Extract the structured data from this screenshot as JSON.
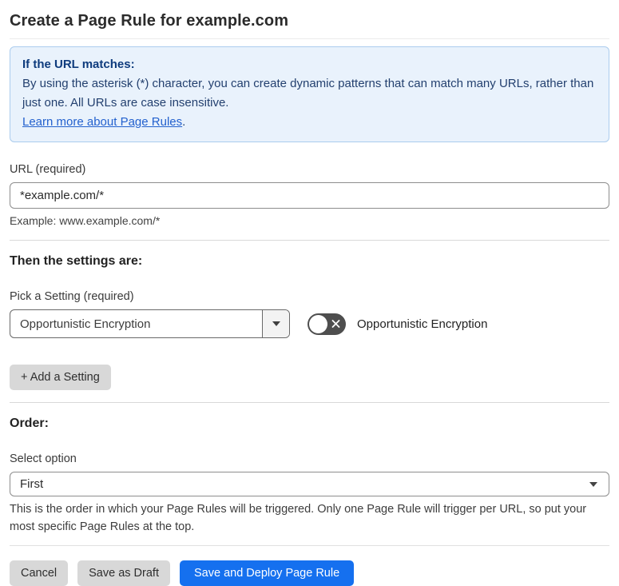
{
  "page": {
    "title": "Create a Page Rule for example.com"
  },
  "info_box": {
    "heading": "If the URL matches:",
    "body": "By using the asterisk (*) character, you can create dynamic patterns that can match many URLs, rather than just one. All URLs are case insensitive.",
    "link_label": "Learn more about Page Rules",
    "link_suffix": "."
  },
  "url_field": {
    "label": "URL (required)",
    "value": "*example.com/*",
    "helper": "Example: www.example.com/*"
  },
  "settings_section": {
    "heading": "Then the settings are:",
    "picker_label": "Pick a Setting (required)",
    "picker_value": "Opportunistic Encryption",
    "toggle_state": "off",
    "toggle_label": "Opportunistic Encryption",
    "add_setting_label": "+ Add a Setting"
  },
  "order_section": {
    "heading": "Order:",
    "select_label": "Select option",
    "select_value": "First",
    "helper": "This is the order in which your Page Rules will be triggered. Only one Page Rule will trigger per URL, so put your most specific Page Rules at the top."
  },
  "actions": {
    "cancel_label": "Cancel",
    "save_draft_label": "Save as Draft",
    "save_deploy_label": "Save and Deploy Page Rule"
  },
  "colors": {
    "accent_blue": "#1570ef",
    "info_background": "#e9f2fc",
    "info_border": "#abccee",
    "info_text": "#23406f",
    "link_blue": "#2361ce",
    "toggle_off_background": "#4e4e4e"
  }
}
